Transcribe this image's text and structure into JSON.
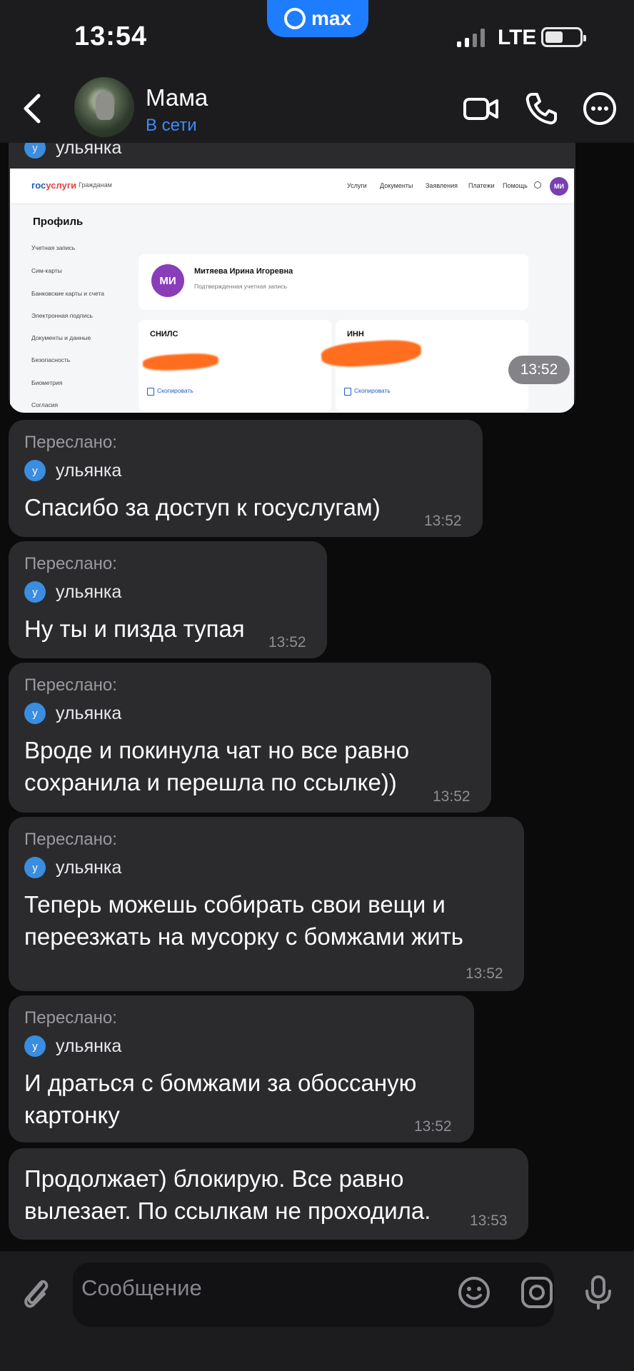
{
  "status_bar": {
    "time": "13:54",
    "app_pill": "max",
    "network": "LTE"
  },
  "header": {
    "back_label": "Back",
    "contact_name": "Мама",
    "contact_status": "В сети"
  },
  "image_message": {
    "sender": "ульянка",
    "sender_initial": "у",
    "time": "13:52",
    "screenshot": {
      "logo_a": "гос",
      "logo_b": "услуги",
      "audience": "Гражданам",
      "nav": [
        "Услуги",
        "Документы",
        "Заявления",
        "Платежи",
        "Помощь"
      ],
      "avatar_initials": "МИ",
      "page_title": "Профиль",
      "sidebar": [
        "Учетная запись",
        "Сим-карты",
        "Банковские карты и счета",
        "Электронная подпись",
        "Документы и данные",
        "Безопасность",
        "Биометрия",
        "Согласия"
      ],
      "profile_initials": "МИ",
      "full_name": "Митяева Ирина Игоревна",
      "confirmed": "Подтвержденная учетная запись",
      "snils_label": "СНИЛС",
      "inn_label": "ИНН",
      "copy_label": "Скопировать"
    }
  },
  "messages": [
    {
      "forwarded": "Переслано:",
      "sender": "ульянка",
      "initial": "у",
      "text": "Спасибо за доступ к госуслугам)",
      "time": "13:52"
    },
    {
      "forwarded": "Переслано:",
      "sender": "ульянка",
      "initial": "у",
      "text": "Ну ты и пизда тупая",
      "time": "13:52"
    },
    {
      "forwarded": "Переслано:",
      "sender": "ульянка",
      "initial": "у",
      "text": "Вроде и покинула чат но все равно\nсохранила и перешла по ссылке))",
      "time": "13:52"
    },
    {
      "forwarded": "Переслано:",
      "sender": "ульянка",
      "initial": "у",
      "text": "Теперь можешь собирать свои вещи и\nпереезжать на мусорку с бомжами жить",
      "time": "13:52"
    },
    {
      "forwarded": "Переслано:",
      "sender": "ульянка",
      "initial": "у",
      "text": "И драться с бомжами за обоссаную\nкартонку",
      "time": "13:52"
    },
    {
      "text": "Продолжает) блокирую. Все равно\nвылезает. По ссылкам не проходила.",
      "time": "13:53"
    }
  ],
  "input": {
    "placeholder": "Сообщение"
  },
  "icons": {
    "attach": "paperclip-icon",
    "emoji": "emoji-icon",
    "camera": "camera-icon",
    "mic": "microphone-icon",
    "video": "video-call-icon",
    "phone": "phone-icon",
    "more": "more-icon"
  },
  "colors": {
    "background": "#0b0b0c",
    "bubble": "#2b2b2e",
    "accent": "#1e7cff",
    "online": "#3d8bff",
    "sender_dot": "#3a8ddf",
    "redaction": "#ff6d1f"
  }
}
